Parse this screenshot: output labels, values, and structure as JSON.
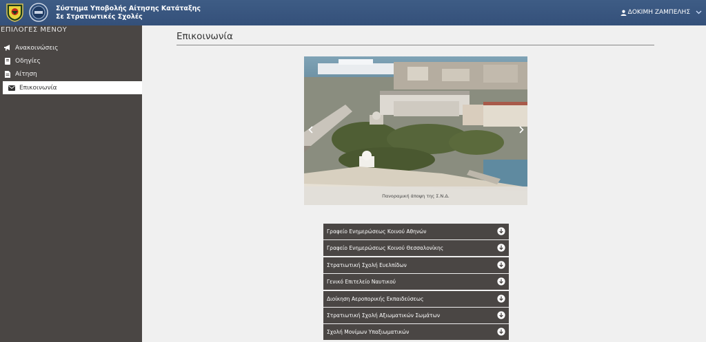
{
  "header": {
    "title_line1": "Σύστημα Υποβολής Αίτησης Κατάταξης",
    "title_line2": "Σε Στρατιωτικές Σχολές",
    "user_name": "ΔΟΚΙΜΗ ΖΑΜΠΕΛΗΣ",
    "user_icon": "user-icon",
    "dropdown_icon": "chevron-down-icon",
    "colors": {
      "bar": "#3e5c85",
      "sidebar": "#4a4644"
    }
  },
  "sidebar": {
    "heading": "ΕΠΙΛΟΓΕΣ ΜΕΝΟΥ",
    "items": [
      {
        "label": "Ανακοινώσεις",
        "icon": "bullhorn-icon",
        "active": false
      },
      {
        "label": "Οδηγίες",
        "icon": "book-icon",
        "active": false
      },
      {
        "label": "Αίτηση",
        "icon": "document-icon",
        "active": false
      },
      {
        "label": "Επικοινωνία",
        "icon": "envelope-icon",
        "active": true
      }
    ]
  },
  "main": {
    "title": "Επικοινωνία",
    "carousel": {
      "caption": "Πανοραμική άποψη της Σ.Ν.Δ.",
      "prev_icon": "chevron-left-icon",
      "next_icon": "chevron-right-icon"
    },
    "accordion": [
      {
        "label": "Γραφείο Ενημερώσεως Κοινού Αθηνών",
        "icon": "circle-arrow-down-icon"
      },
      {
        "label": "Γραφείο Ενημερώσεως Κοινού Θεσσαλονίκης",
        "icon": "circle-arrow-down-icon"
      },
      {
        "label": "Στρατιωτική Σχολή Ευελπίδων",
        "icon": "circle-arrow-down-icon"
      },
      {
        "label": "Γενικό Επιτελείο Ναυτικού",
        "icon": "circle-arrow-down-icon"
      },
      {
        "label": "Διοίκηση Αεροπορικής Εκπαιδεύσεως",
        "icon": "circle-arrow-down-icon"
      },
      {
        "label": "Στρατιωτική Σχολή Αξιωματικών Σωμάτων",
        "icon": "circle-arrow-down-icon"
      },
      {
        "label": "Σχολή Μονίμων Υπαξιωματικών",
        "icon": "circle-arrow-down-icon"
      }
    ]
  }
}
